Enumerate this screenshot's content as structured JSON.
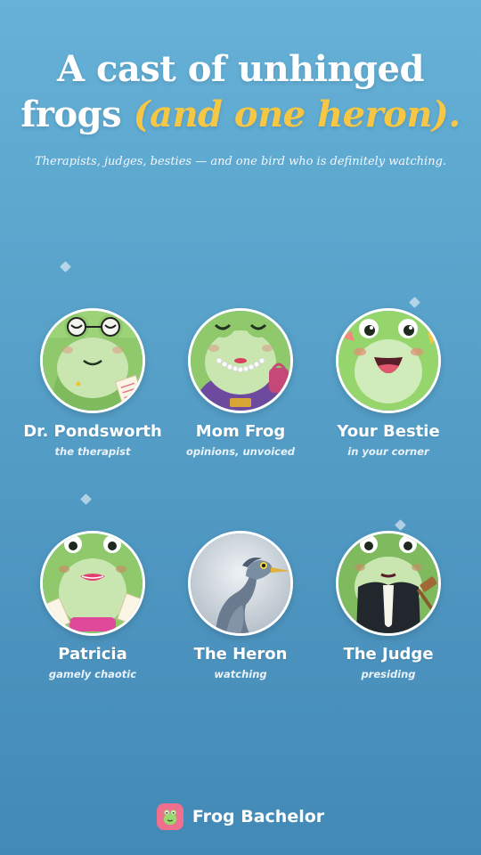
{
  "headline": {
    "line1": "A cast of unhinged",
    "line2_plain": "frogs ",
    "line2_accent": "(and one heron)."
  },
  "subtitle": "Therapists, judges, besties — and one bird who is definitely watching.",
  "characters": [
    {
      "name": "Dr. Pondsworth",
      "role": "the therapist",
      "icon": "therapist-frog-icon"
    },
    {
      "name": "Mom Frog",
      "role": "opinions, unvoiced",
      "icon": "mom-frog-icon"
    },
    {
      "name": "Your Bestie",
      "role": "in your corner",
      "icon": "bestie-frog-icon"
    },
    {
      "name": "Patricia",
      "role": "gamely chaotic",
      "icon": "patricia-frog-icon"
    },
    {
      "name": "The Heron",
      "role": "watching",
      "icon": "heron-icon"
    },
    {
      "name": "The Judge",
      "role": "presiding",
      "icon": "judge-frog-icon"
    }
  ],
  "brand": {
    "name": "Frog Bachelor",
    "icon": "frog-logo-icon"
  },
  "colors": {
    "accent": "#f6c744",
    "frog_green": "#8fce6a",
    "brand_pink": "#ee6f8e"
  }
}
